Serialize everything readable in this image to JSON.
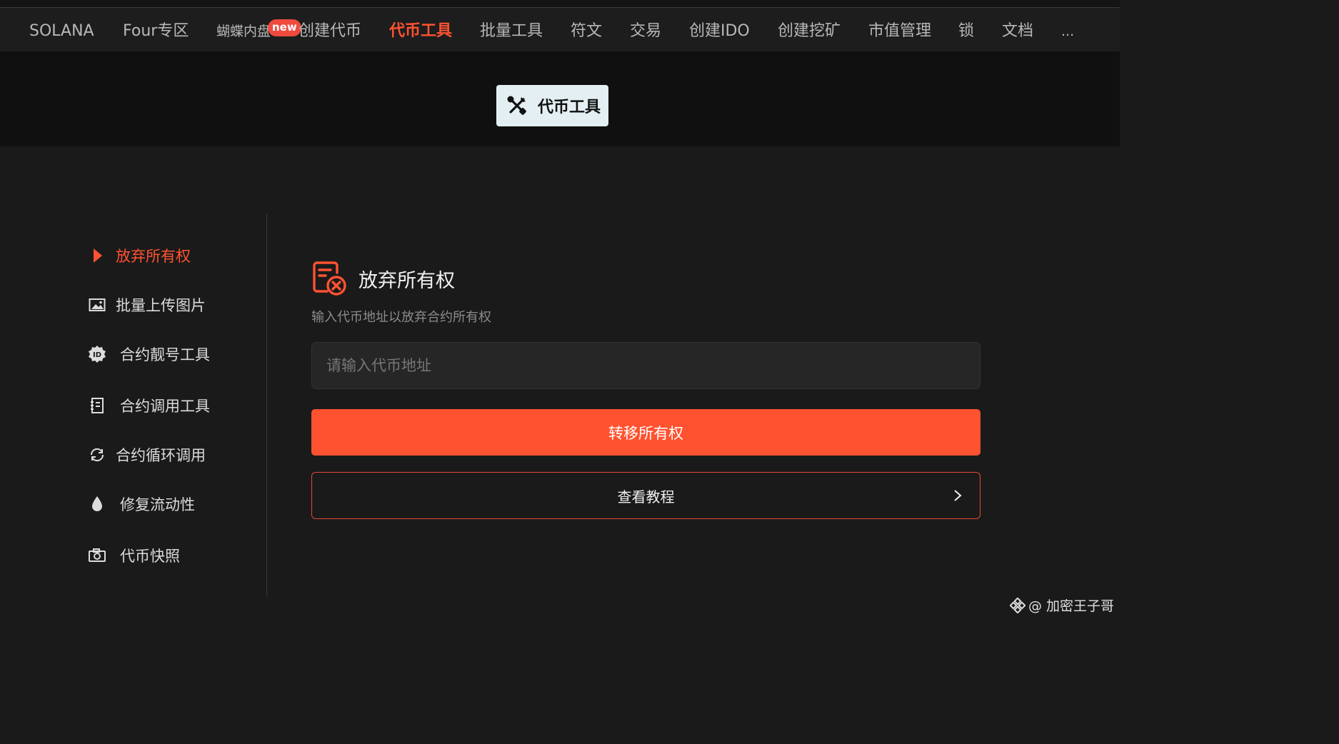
{
  "nav": {
    "items": [
      {
        "label": "SOLANA"
      },
      {
        "label": "Four专区"
      },
      {
        "label": "蝴蝶内盘"
      },
      {
        "label": "创建代币"
      },
      {
        "label": "代币工具"
      },
      {
        "label": "批量工具"
      },
      {
        "label": "符文"
      },
      {
        "label": "交易"
      },
      {
        "label": "创建IDO"
      },
      {
        "label": "创建挖矿"
      },
      {
        "label": "市值管理"
      },
      {
        "label": "锁"
      },
      {
        "label": "文档"
      },
      {
        "label": "..."
      }
    ],
    "badge": "new",
    "active_index": 4,
    "accent_color": "#ff5232"
  },
  "header": {
    "title": "代币工具",
    "icon": "tools-icon"
  },
  "sidebar": {
    "items": [
      {
        "label": "放弃所有权",
        "icon": "play-triangle-icon",
        "active": true
      },
      {
        "label": "批量上传图片",
        "icon": "image-icon"
      },
      {
        "label": "合约靓号工具",
        "icon": "id-badge-icon"
      },
      {
        "label": "合约调用工具",
        "icon": "contract-book-icon"
      },
      {
        "label": "合约循环调用",
        "icon": "refresh-icon"
      },
      {
        "label": "修复流动性",
        "icon": "drop-icon"
      },
      {
        "label": "代币快照",
        "icon": "camera-icon"
      }
    ]
  },
  "main": {
    "title": "放弃所有权",
    "icon": "document-cancel-icon",
    "description": "输入代币地址以放弃合约所有权",
    "input_placeholder": "请输入代币地址",
    "input_value": "",
    "primary_button": "转移所有权",
    "secondary_button": "查看教程",
    "primary_color": "#ff5230"
  },
  "watermark": {
    "text": "@ 加密王子哥"
  }
}
